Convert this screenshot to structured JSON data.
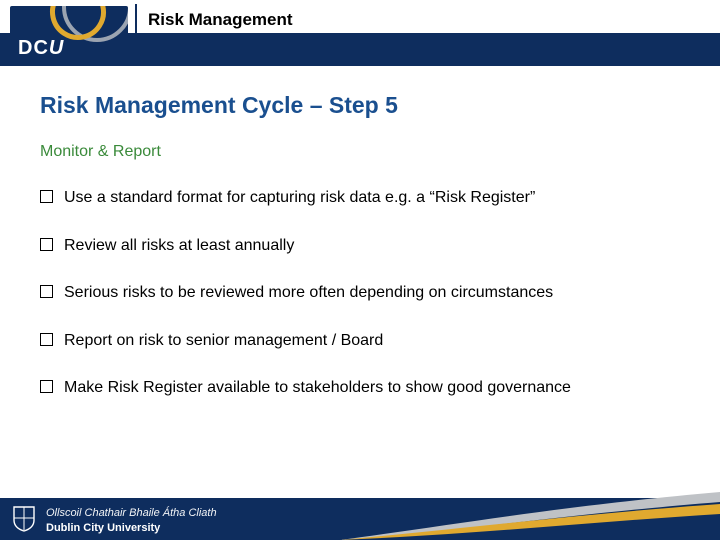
{
  "brand": {
    "logo_text": "DCU",
    "footer_ga": "Ollscoil Chathair Bhaile Átha Cliath",
    "footer_en": "Dublin City University"
  },
  "header": {
    "label": "Risk Management"
  },
  "slide": {
    "heading": "Risk Management Cycle – Step 5",
    "subheading": "Monitor & Report",
    "bullets": [
      "Use a standard format for capturing risk data e.g. a “Risk Register”",
      "Review all risks at least annually",
      "Serious risks to be reviewed more often depending on circumstances",
      "Report on risk to senior management / Board",
      "Make Risk Register available to stakeholders to show good governance"
    ]
  },
  "colors": {
    "navy": "#0e2d5e",
    "gold": "#e0a92f",
    "blue": "#1a4f8f",
    "green": "#3a8a3a"
  }
}
